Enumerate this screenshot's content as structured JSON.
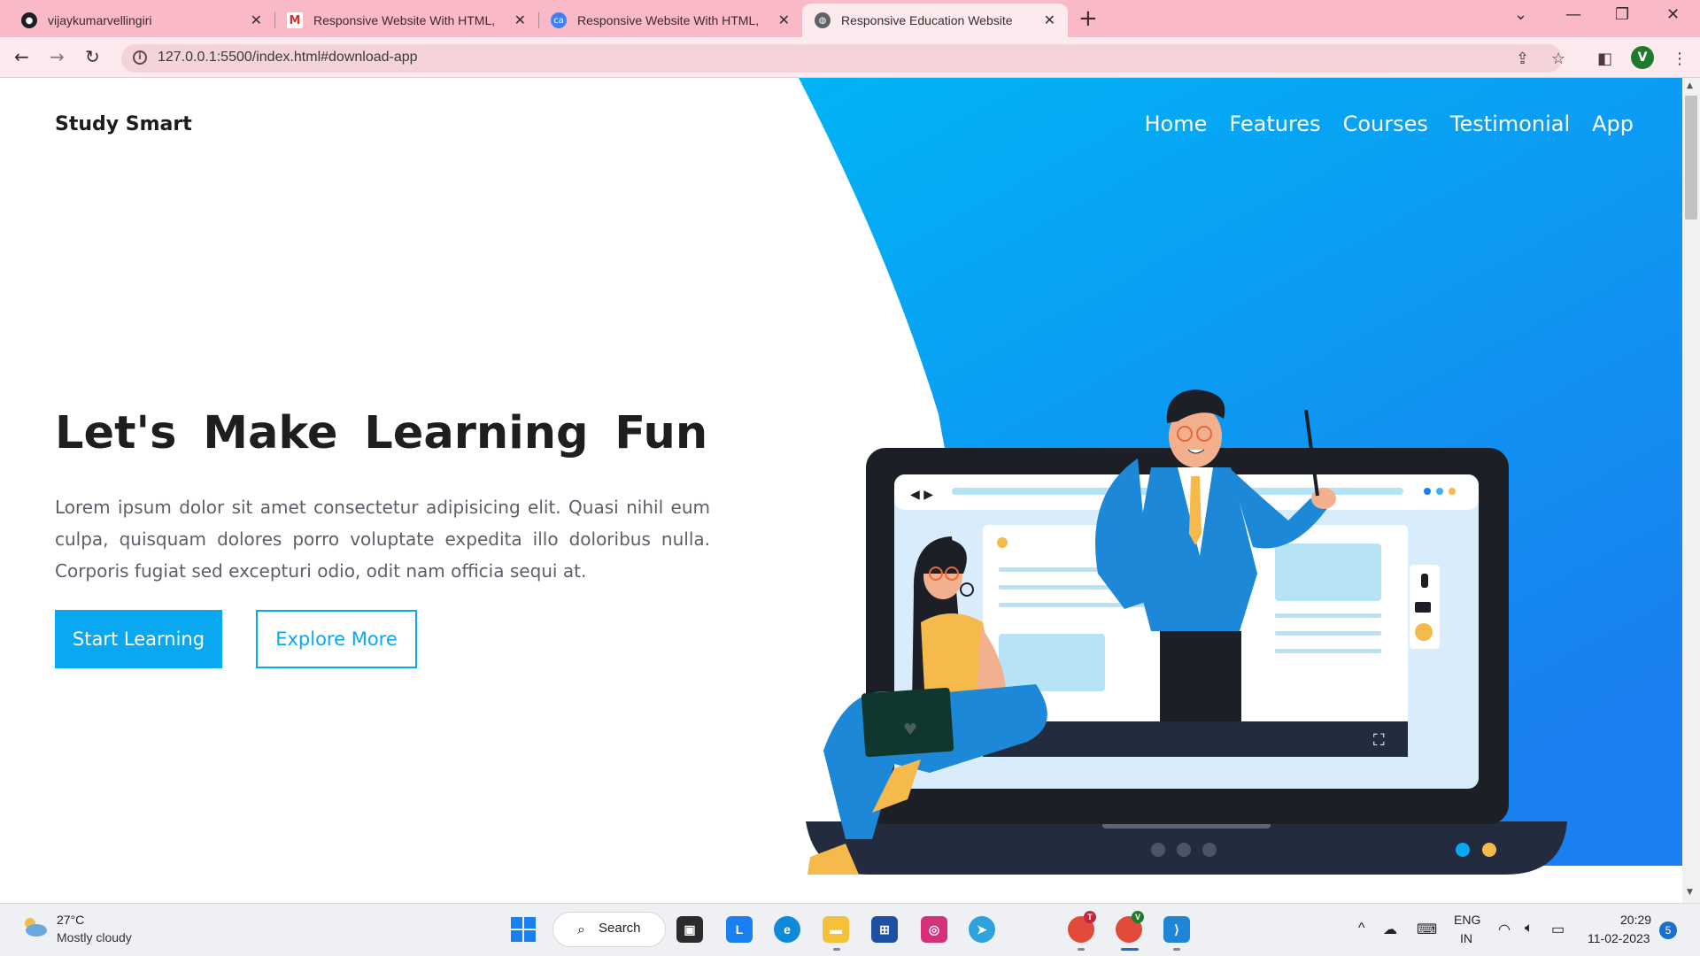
{
  "browser": {
    "tabs": [
      {
        "title": "vijaykumarvellingiri",
        "icon": "github-icon"
      },
      {
        "title": "Responsive Website With HTML,",
        "icon": "gmail-icon"
      },
      {
        "title": "Responsive Website With HTML,",
        "icon": "codeanywhere-icon"
      },
      {
        "title": "Responsive Education Website",
        "icon": "globe-icon",
        "active": true
      }
    ],
    "url": "127.0.0.1:5500/index.html#download-app",
    "profile_initial": "V"
  },
  "page": {
    "brand": "Study Smart",
    "nav": [
      "Home",
      "Features",
      "Courses",
      "Testimonial",
      "App"
    ],
    "hero": {
      "title": "Let's Make Learning Fun",
      "text": "Lorem ipsum dolor sit amet consectetur adipisicing elit. Quasi nihil eum culpa, quisquam dolores porro voluptate expedita illo doloribus nulla. Corporis fugiat sed excepturi odio, odit nam officia sequi at.",
      "primary_button": "Start Learning",
      "secondary_button": "Explore More"
    },
    "colors": {
      "accent": "#0aa8f0",
      "accent_dark": "#1a7ff0"
    }
  },
  "taskbar": {
    "weather_temp": "27°C",
    "weather_desc": "Mostly cloudy",
    "search_label": "Search",
    "lang_1": "ENG",
    "lang_2": "IN",
    "time": "20:29",
    "date": "11-02-2023",
    "notification_count": "5",
    "chrome_badge_1": "T",
    "chrome_badge_2": "V"
  }
}
